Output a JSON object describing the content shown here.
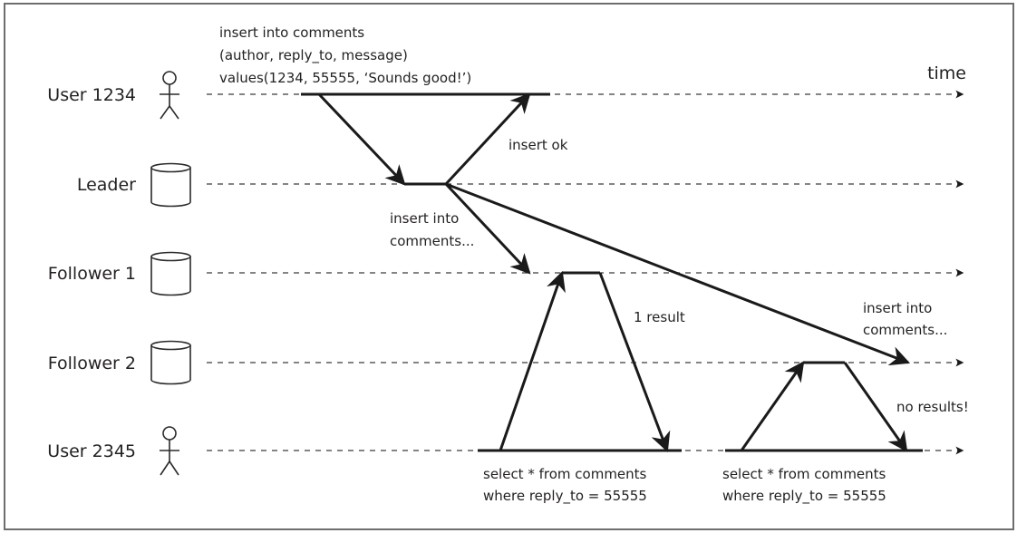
{
  "diagram": {
    "type": "sequence",
    "time_label": "time",
    "actors": [
      {
        "id": "user1234",
        "label": "User 1234",
        "icon": "person-icon"
      },
      {
        "id": "leader",
        "label": "Leader",
        "icon": "database-icon"
      },
      {
        "id": "follower1",
        "label": "Follower 1",
        "icon": "database-icon"
      },
      {
        "id": "follower2",
        "label": "Follower 2",
        "icon": "database-icon"
      },
      {
        "id": "user2345",
        "label": "User 2345",
        "icon": "person-icon"
      }
    ],
    "messages": [
      {
        "from": "user1234",
        "to": "leader",
        "label": ""
      },
      {
        "from": "leader",
        "to": "user1234",
        "label": "insert ok"
      },
      {
        "from": "leader",
        "to": "follower1",
        "label": "insert into comments..."
      },
      {
        "from": "leader",
        "to": "follower2",
        "label": "insert into comments..."
      },
      {
        "from": "user2345",
        "to": "follower1",
        "label": ""
      },
      {
        "from": "follower1",
        "to": "user2345",
        "label": "1 result"
      },
      {
        "from": "user2345",
        "to": "follower2",
        "label": ""
      },
      {
        "from": "follower2",
        "to": "user2345",
        "label": "no results!"
      }
    ],
    "notes": {
      "write_query": [
        "insert into comments",
        "(author, reply_to, message)",
        "values(1234, 55555, ‘Sounds good!’)"
      ],
      "insert_ok": "insert ok",
      "replicate_f1": [
        "insert into",
        "comments..."
      ],
      "replicate_f2": [
        "insert into",
        "comments..."
      ],
      "one_result": "1 result",
      "no_results": "no results!",
      "read_query_1": [
        "select * from comments",
        "where reply_to = 55555"
      ],
      "read_query_2": [
        "select * from comments",
        "where reply_to = 55555"
      ]
    }
  }
}
